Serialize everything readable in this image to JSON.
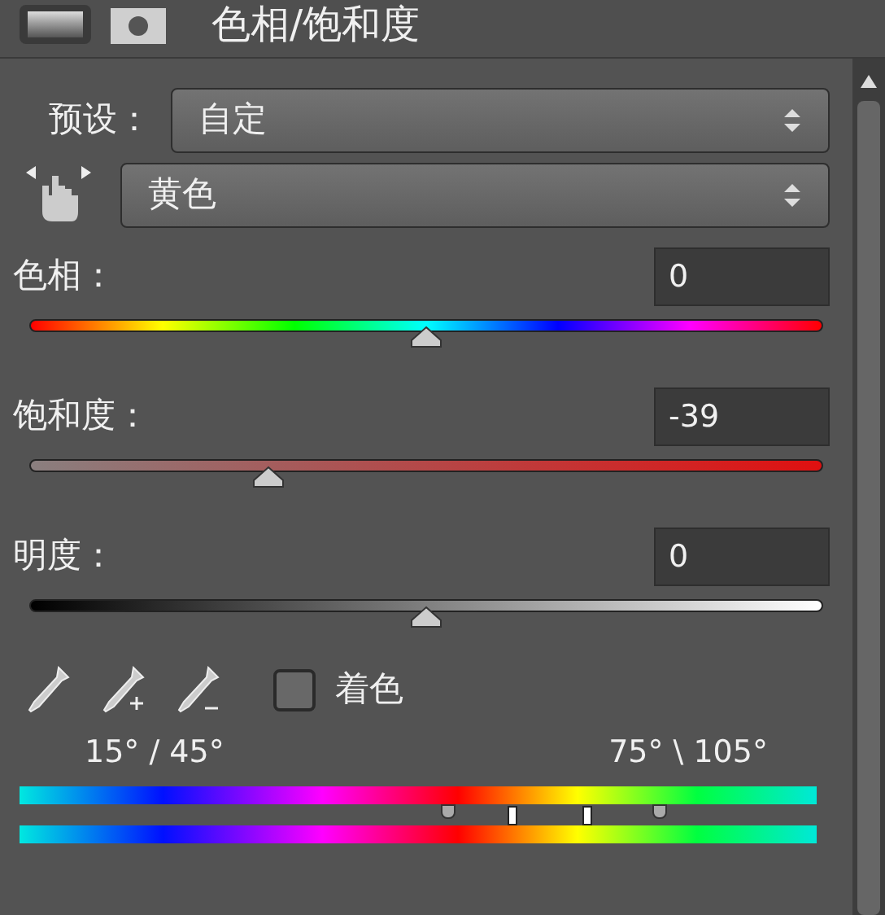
{
  "panel": {
    "title": "色相/饱和度"
  },
  "preset": {
    "label": "预设：",
    "value": "自定"
  },
  "channel": {
    "value": "黄色"
  },
  "sliders": [
    {
      "label": "色相：",
      "value": "0",
      "level": 0.5,
      "kind": "hue"
    },
    {
      "label": "饱和度：",
      "value": "-39",
      "level": 0.3,
      "kind": "saturation"
    },
    {
      "label": "明度：",
      "value": "0",
      "level": 0.5,
      "kind": "lightness"
    }
  ],
  "colorize": {
    "label": "着色",
    "checked": false
  },
  "range": {
    "left_label": "15° / 45°",
    "right_label": "75° \\ 105°",
    "handles": [
      {
        "kind": "outer",
        "level": 0.537
      },
      {
        "kind": "inner",
        "level": 0.62
      },
      {
        "kind": "inner",
        "level": 0.714
      },
      {
        "kind": "outer",
        "level": 0.802
      }
    ]
  }
}
